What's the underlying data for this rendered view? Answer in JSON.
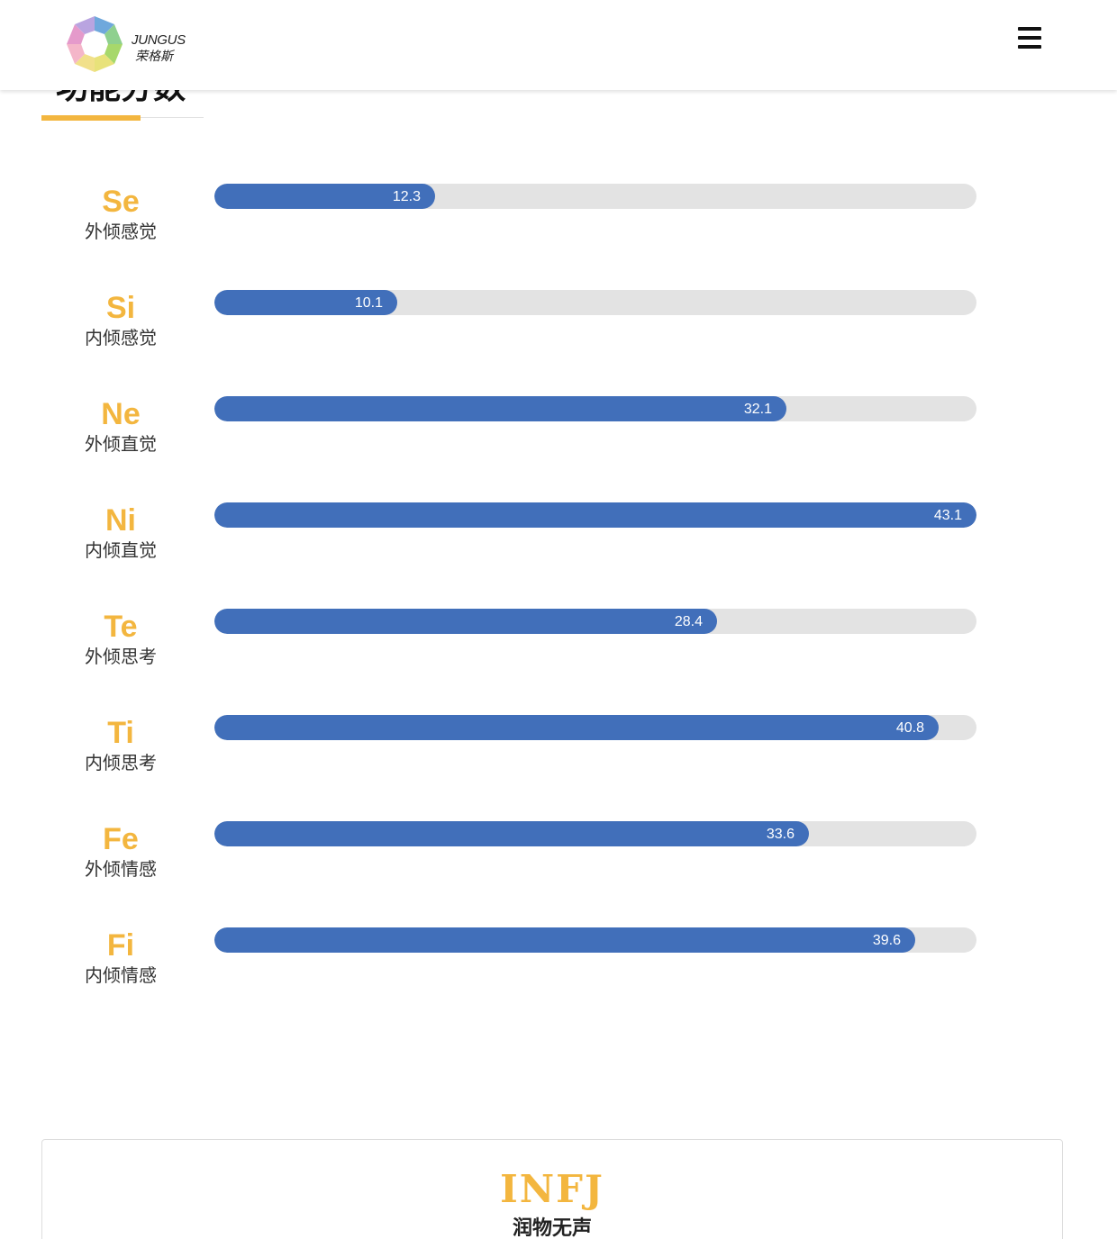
{
  "header": {
    "logo": {
      "en": "JUNGUS",
      "cn": "荣格斯"
    },
    "menu_icon": "hamburger-menu-icon"
  },
  "section": {
    "title": "功能分数"
  },
  "colors": {
    "accent": "#f3b63f",
    "bar": "#416fba",
    "track": "#e3e3e3"
  },
  "functions": [
    {
      "code": "Se",
      "name": "外倾感觉",
      "value": "12.3",
      "fill_fraction": 0.29
    },
    {
      "code": "Si",
      "name": "内倾感觉",
      "value": "10.1",
      "fill_fraction": 0.24
    },
    {
      "code": "Ne",
      "name": "外倾直觉",
      "value": "32.1",
      "fill_fraction": 0.75
    },
    {
      "code": "Ni",
      "name": "内倾直觉",
      "value": "43.1",
      "fill_fraction": 1.0
    },
    {
      "code": "Te",
      "name": "外倾思考",
      "value": "28.4",
      "fill_fraction": 0.66
    },
    {
      "code": "Ti",
      "name": "内倾思考",
      "value": "40.8",
      "fill_fraction": 0.95
    },
    {
      "code": "Fe",
      "name": "外倾情感",
      "value": "33.6",
      "fill_fraction": 0.78
    },
    {
      "code": "Fi",
      "name": "内倾情感",
      "value": "39.6",
      "fill_fraction": 0.92
    }
  ],
  "result": {
    "type": "INFJ",
    "nickname": "润物无声"
  }
}
